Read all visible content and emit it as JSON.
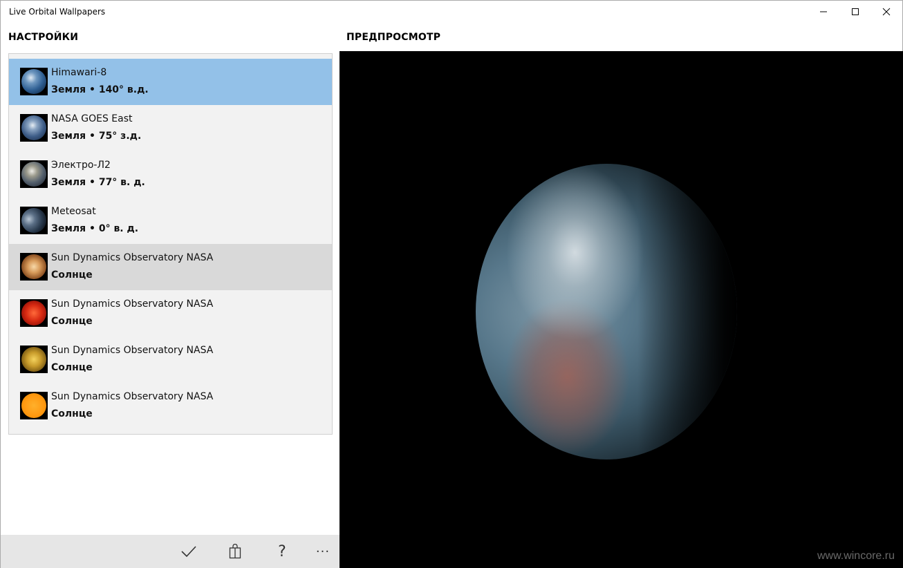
{
  "window": {
    "title": "Live Orbital Wallpapers"
  },
  "settings": {
    "title": "НАСТРОЙКИ"
  },
  "preview": {
    "title": "ПРЕДПРОСМОТР",
    "watermark": "www.wincore.ru"
  },
  "sources": {
    "items": [
      {
        "name": "Himawari-8",
        "sub": "Земля • 140° в.д.",
        "icon": "earth-thumbnail-icon",
        "state": "selected"
      },
      {
        "name": "NASA GOES East",
        "sub": "Земля • 75° з.д.",
        "icon": "earth-thumbnail-icon",
        "state": "normal"
      },
      {
        "name": "Электро-Л2",
        "sub": "Земля • 77° в. д.",
        "icon": "earth-thumbnail-icon",
        "state": "normal"
      },
      {
        "name": "Meteosat",
        "sub": "Земля • 0° в. д.",
        "icon": "earth-thumbnail-icon",
        "state": "normal"
      },
      {
        "name": "Sun Dynamics Observatory NASA",
        "sub": "Солнце",
        "icon": "sun-thumbnail-icon",
        "state": "hover"
      },
      {
        "name": "Sun Dynamics Observatory NASA",
        "sub": "Солнце",
        "icon": "sun-thumbnail-icon",
        "state": "normal"
      },
      {
        "name": "Sun Dynamics Observatory NASA",
        "sub": "Солнце",
        "icon": "sun-thumbnail-icon",
        "state": "normal"
      },
      {
        "name": "Sun Dynamics Observatory NASA",
        "sub": "Солнце",
        "icon": "sun-thumbnail-icon",
        "state": "normal"
      }
    ]
  },
  "toolbar": {
    "help_glyph": "?",
    "more_glyph": "···"
  },
  "colors": {
    "selected": "#93c1e8",
    "hover": "#d9d9d9",
    "list_bg": "#f2f2f2",
    "toolbar_bg": "#e6e6e6",
    "preview_bg": "#000000"
  }
}
